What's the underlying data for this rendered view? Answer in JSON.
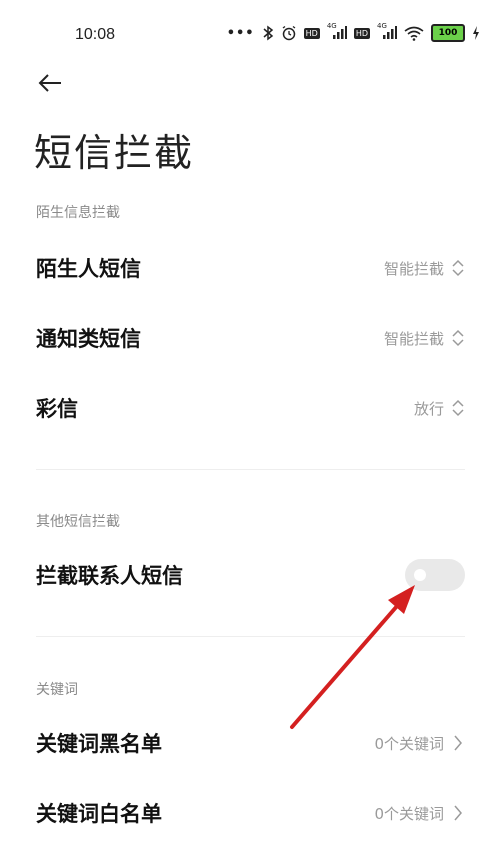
{
  "status_bar": {
    "time": "10:08",
    "icons": [
      "more-dots-icon",
      "bluetooth-icon",
      "alarm-icon",
      "hd-icon",
      "signal-4g-icon",
      "hd-icon",
      "signal-4g-icon",
      "wifi-icon",
      "battery-icon",
      "charging-icon"
    ],
    "net_label_1": "4G",
    "net_label_2": "4G",
    "hd_label": "HD",
    "battery_percent": "100"
  },
  "header": {
    "back_icon": "back-arrow-icon",
    "title": "短信拦截"
  },
  "sections": {
    "stranger": {
      "header": "陌生信息拦截",
      "rows": [
        {
          "label": "陌生人短信",
          "value": "智能拦截"
        },
        {
          "label": "通知类短信",
          "value": "智能拦截"
        },
        {
          "label": "彩信",
          "value": "放行"
        }
      ]
    },
    "other": {
      "header": "其他短信拦截",
      "toggle_row": {
        "label": "拦截联系人短信",
        "enabled": false
      }
    },
    "keywords": {
      "header": "关键词",
      "rows": [
        {
          "label": "关键词黑名单",
          "value": "0个关键词"
        },
        {
          "label": "关键词白名单",
          "value": "0个关键词"
        }
      ]
    }
  },
  "colors": {
    "annotation_arrow": "#d42020",
    "battery_fill": "#6bd14a",
    "toggle_off": "#e9e9e9"
  }
}
